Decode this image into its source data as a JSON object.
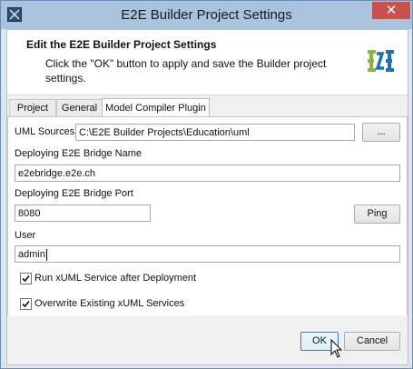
{
  "window": {
    "title": "E2E Builder Project Settings",
    "close_glyph": "✕"
  },
  "banner": {
    "title": "Edit the E2E Builder Project Settings",
    "text": "Click the \"OK\" button to apply and save the Builder project settings.",
    "logo_icon": "e2e-logo"
  },
  "tabs": [
    {
      "label": "Project",
      "active": false
    },
    {
      "label": "General",
      "active": false
    },
    {
      "label": "Model Compiler Plugin",
      "active": true
    }
  ],
  "form": {
    "uml_sources_label": "UML Sources",
    "uml_sources_value": "C:\\E2E Builder Projects\\Education\\uml",
    "browse_label": "...",
    "bridge_name_label": "Deploying E2E Bridge Name",
    "bridge_name_value": "e2ebridge.e2e.ch",
    "bridge_port_label": "Deploying E2E Bridge Port",
    "bridge_port_value": "8080",
    "ping_label": "Ping",
    "user_label": "User",
    "user_value": "admin",
    "run_service_label": "Run xUML Service after Deployment",
    "run_service_checked": true,
    "overwrite_label": "Overwrite Existing xUML Services",
    "overwrite_checked": true
  },
  "footer": {
    "ok_label": "OK",
    "cancel_label": "Cancel"
  },
  "colors": {
    "accent": "#3c7fb1",
    "logo_green": "#8db43c",
    "logo_blue": "#1f6fb5",
    "close": "#c75050"
  }
}
